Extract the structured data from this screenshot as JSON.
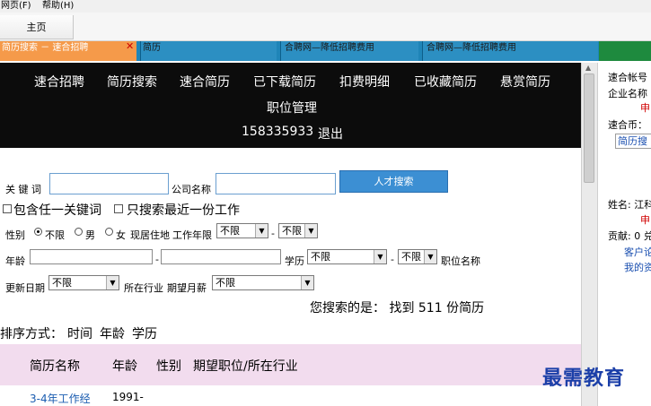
{
  "menubar": {
    "items": [
      "网页(F)",
      "帮助(H)"
    ]
  },
  "toolbar": {
    "home": "主页"
  },
  "tabs": [
    {
      "label": "简历搜索 － 速合招聘",
      "close": "✕"
    },
    {
      "label": "简历"
    },
    {
      "label": "合聘网—降低招聘费用"
    },
    {
      "label": "合聘网—降低招聘费用"
    }
  ],
  "nav": {
    "row1": [
      "速合招聘",
      "简历搜索",
      "速合简历",
      "已下载简历",
      "扣费明细",
      "已收藏简历",
      "悬赏简历"
    ],
    "row2": [
      "职位管理"
    ],
    "phone": "158335933",
    "logout": "退出"
  },
  "search": {
    "keyword_label": "关 键 词",
    "keyword_value": "",
    "company_label": "公司名称",
    "company_value": "",
    "search_button": "人才搜索",
    "opt_any_keyword": "包含任一关键词",
    "opt_recent_only": "只搜索最近一份工作",
    "gender_label": "性别",
    "gender_options": [
      "不限",
      "男",
      "女"
    ],
    "residence_label": "现居住地",
    "work_years_label": "工作年限",
    "work_years_from": "不限",
    "work_years_to": "不限",
    "age_label": "年龄",
    "age_dash": "-",
    "education_label": "学历",
    "education_from": "不限",
    "education_to": "不限",
    "position_label": "职位名称",
    "update_label": "更新日期",
    "update_value": "不限",
    "industry_label": "所在行业",
    "salary_label": "期望月薪",
    "salary_value": "不限",
    "dash": "-"
  },
  "result": {
    "text": "您搜索的是：  找到  511 份简历"
  },
  "sort": {
    "label": "排序方式：",
    "options": [
      "时间",
      "年龄",
      "学历"
    ]
  },
  "table": {
    "headers": [
      "简历名称",
      "年龄",
      "性别",
      "期望职位/所在行业"
    ],
    "first_row": [
      "3-4年工作经",
      "1991-"
    ]
  },
  "right_panel": {
    "account_label": "速合帐号",
    "company_label": "企业名称",
    "red1": "申",
    "coin_label": "速合币：",
    "box_label": "简历搜",
    "name_label": "姓名: 江科",
    "red2": "申",
    "contrib": "贡献: 0 兑",
    "link1": "客户论",
    "link2": "我的资"
  },
  "watermark": "最需教育"
}
